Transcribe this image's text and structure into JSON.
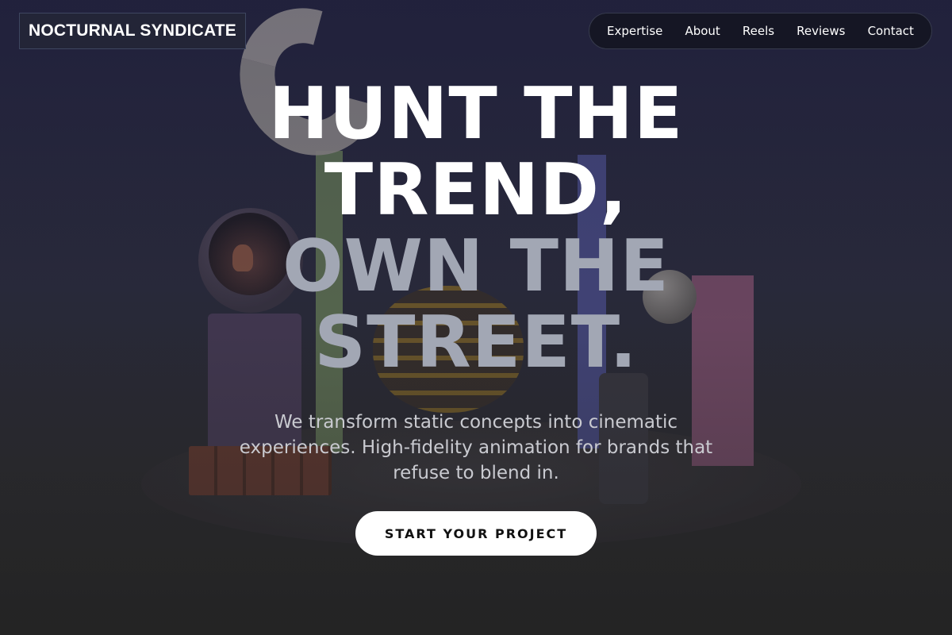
{
  "brand": {
    "name": "NOCTURNAL SYNDICATE"
  },
  "nav": {
    "items": [
      {
        "label": "Expertise"
      },
      {
        "label": "About"
      },
      {
        "label": "Reels"
      },
      {
        "label": "Reviews"
      },
      {
        "label": "Contact"
      }
    ]
  },
  "hero": {
    "headline_lines": [
      "HUNT THE",
      "TREND,",
      "OWN THE",
      "STREET."
    ],
    "subtext": "We transform static concepts into cinematic experiences. High-fidelity animation for brands that refuse to blend in.",
    "cta_label": "START YOUR PROJECT"
  },
  "colors": {
    "headline_primary": "#ffffff",
    "headline_secondary": "#a2a7b4",
    "cta_background": "#ffffff",
    "cta_text": "#111111"
  }
}
